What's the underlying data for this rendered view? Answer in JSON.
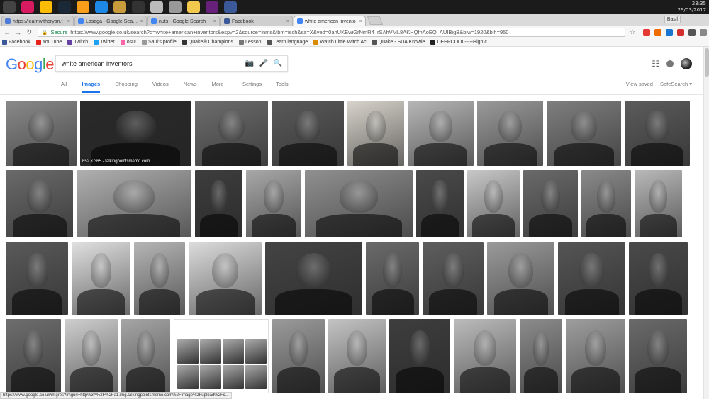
{
  "taskbar": {
    "clock_time": "23:35",
    "clock_date": "29/03/2017",
    "icons": [
      "window-icon",
      "opera-icon",
      "chrome-icon",
      "steam-icon",
      "overwatch-icon",
      "ccleaner-icon",
      "league-icon",
      "epic-icon",
      "disc-icon",
      "disc-icon",
      "folder-icon",
      "visual-studio-icon",
      "facebook-icon"
    ]
  },
  "browser": {
    "user_badge": "Basil",
    "tabs": [
      {
        "label": "https://learnwithoryan.t",
        "active": false,
        "fav_color": "#4e7bd6"
      },
      {
        "label": "Lasaga - Google Search",
        "active": false,
        "fav_color": "#4285f4"
      },
      {
        "label": "nuts - Google Search",
        "active": false,
        "fav_color": "#4285f4"
      },
      {
        "label": "Facebook",
        "active": false,
        "fav_color": "#3b5998"
      },
      {
        "label": "white american invento",
        "active": true,
        "fav_color": "#4285f4"
      }
    ],
    "secure_label": "Secure",
    "url": "https://www.google.co.uk/search?q=white+american+inventors&espv=2&source=lnms&tbm=isch&sa=X&ved=0ahUKEwiGrNmR4_rSAhVML8AKHQfhAoEQ_AUIBigB&biw=1920&bih=950",
    "bookmarks": [
      {
        "label": "Facebook",
        "color": "#3b5998"
      },
      {
        "label": "YouTube",
        "color": "#e62117"
      },
      {
        "label": "Twitch",
        "color": "#6441a5"
      },
      {
        "label": "Twitter",
        "color": "#1da1f2"
      },
      {
        "label": "osu!",
        "color": "#ff66aa"
      },
      {
        "label": "Saul's profile",
        "color": "#999999"
      },
      {
        "label": "Quake® Champions",
        "color": "#333333"
      },
      {
        "label": "Lesson",
        "color": "#777777"
      },
      {
        "label": "Learn language",
        "color": "#555555"
      },
      {
        "label": "Watch Little Witch Ac",
        "color": "#d98c00"
      },
      {
        "label": "Quake - SDA Knowle",
        "color": "#555555"
      },
      {
        "label": "DEEPCOOL-----High c",
        "color": "#222222"
      }
    ]
  },
  "google": {
    "logo_letters": [
      "G",
      "o",
      "o",
      "g",
      "l",
      "e"
    ],
    "logo_colors": [
      "#4285f4",
      "#ea4335",
      "#fbbc05",
      "#4285f4",
      "#34a853",
      "#ea4335"
    ],
    "query": "white american inventors",
    "nav_tabs": [
      {
        "label": "All",
        "active": false
      },
      {
        "label": "Images",
        "active": true
      },
      {
        "label": "Shopping",
        "active": false
      },
      {
        "label": "Videos",
        "active": false
      },
      {
        "label": "News",
        "active": false
      },
      {
        "label": "More",
        "active": false
      }
    ],
    "settings_label": "Settings",
    "tools_label": "Tools",
    "view_saved_label": "View saved",
    "safesearch_label": "SafeSearch ▾"
  },
  "results": {
    "rows": [
      [
        {
          "w": 100,
          "tone": "#8a8a8a"
        },
        {
          "w": 157,
          "tone": "#2a2a2a",
          "caption": "652 × 365 - talkingpointsmemo.com"
        },
        {
          "w": 103,
          "tone": "#6d6d6d"
        },
        {
          "w": 102,
          "tone": "#5a5a5a"
        },
        {
          "w": 80,
          "tone": "#d8d4cc"
        },
        {
          "w": 93,
          "tone": "#b7b7b7"
        },
        {
          "w": 93,
          "tone": "#9a9a9a"
        },
        {
          "w": 105,
          "tone": "#7f7f7f"
        },
        {
          "w": 92,
          "tone": "#5c5c5c"
        }
      ],
      [
        {
          "w": 95,
          "tone": "#6a6a6a"
        },
        {
          "w": 162,
          "tone": "#b0b0b0"
        },
        {
          "w": 67,
          "tone": "#3d3d3d"
        },
        {
          "w": 78,
          "tone": "#a8a8a8"
        },
        {
          "w": 152,
          "tone": "#909090"
        },
        {
          "w": 67,
          "tone": "#4a4a4a"
        },
        {
          "w": 74,
          "tone": "#c8c8c8"
        },
        {
          "w": 77,
          "tone": "#6a6a6a"
        },
        {
          "w": 70,
          "tone": "#8a8a8a"
        },
        {
          "w": 67,
          "tone": "#b9b9b9"
        }
      ],
      [
        {
          "w": 88,
          "tone": "#5a5a5a"
        },
        {
          "w": 83,
          "tone": "#e0e0e0"
        },
        {
          "w": 72,
          "tone": "#b5b5b5"
        },
        {
          "w": 103,
          "tone": "#dcdcdc"
        },
        {
          "w": 137,
          "tone": "#444444"
        },
        {
          "w": 75,
          "tone": "#6a6a6a"
        },
        {
          "w": 86,
          "tone": "#5e5e5e"
        },
        {
          "w": 95,
          "tone": "#9a9a9a"
        },
        {
          "w": 95,
          "tone": "#555555"
        },
        {
          "w": 83,
          "tone": "#4a4a4a"
        }
      ],
      [
        {
          "w": 78,
          "tone": "#6e6e6e"
        },
        {
          "w": 75,
          "tone": "#cfcfcf"
        },
        {
          "w": 69,
          "tone": "#a6a6a6"
        },
        {
          "w": 134,
          "tone": "#f2f2f2",
          "embedded": true
        },
        {
          "w": 74,
          "tone": "#9b9b9b"
        },
        {
          "w": 81,
          "tone": "#c4c4c4"
        },
        {
          "w": 86,
          "tone": "#3e3e3e"
        },
        {
          "w": 88,
          "tone": "#bcbcbc"
        },
        {
          "w": 60,
          "tone": "#8c8c8c"
        },
        {
          "w": 84,
          "tone": "#9e9e9e"
        },
        {
          "w": 82,
          "tone": "#6a6a6a"
        }
      ]
    ]
  },
  "status_url": "https://www.google.co.uk/imgres?imgurl=http%3A%2F%2Fa1.img.talkingpointsmemo.com%2Fimage%2Fupload%2Fc..."
}
